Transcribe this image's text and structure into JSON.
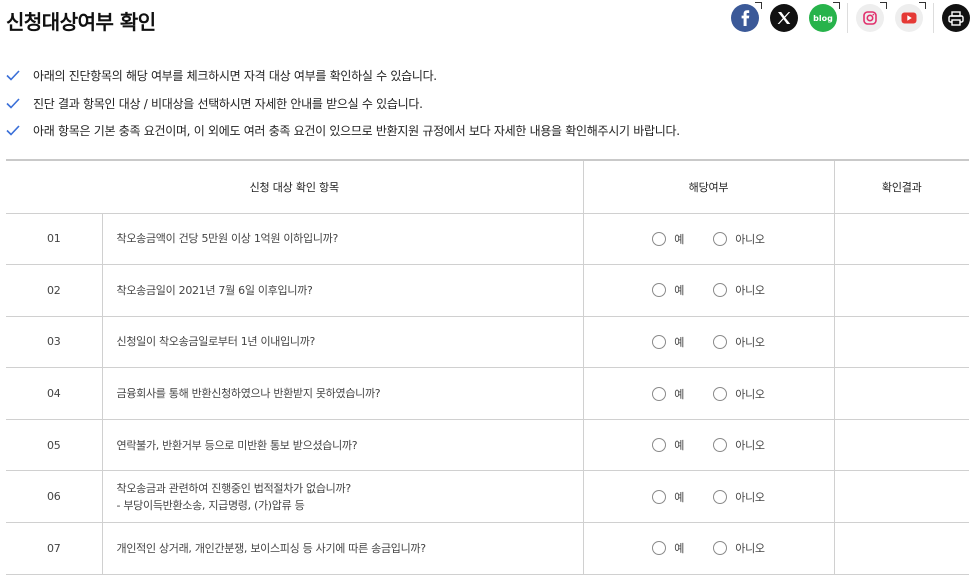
{
  "page": {
    "title": "신청대상여부 확인"
  },
  "share": [
    {
      "name": "facebook-share",
      "icon": "facebook-icon",
      "color": "#3b5998"
    },
    {
      "name": "x-share",
      "icon": "x-icon",
      "color": "#111111"
    },
    {
      "name": "blog-share",
      "icon": "blog-icon",
      "label": "blog",
      "color": "#27b34b"
    },
    {
      "name": "instagram-share",
      "icon": "instagram-icon",
      "color": "#e1306c"
    },
    {
      "name": "youtube-share",
      "icon": "youtube-icon",
      "color": "#e53935"
    },
    {
      "name": "print",
      "icon": "printer-icon",
      "color": "#111111"
    }
  ],
  "notes": [
    "아래의 진단항목의 해당 여부를 체크하시면 자격 대상 여부를 확인하실 수 있습니다.",
    "진단 결과 항목인 대상 / 비대상을 선택하시면 자세한 안내를 받으실 수 있습니다.",
    "아래 항목은 기본 충족 요건이며, 이 외에도 여러 충족 요건이 있으므로 반환지원 규정에서 보다 자세한 내용을 확인해주시기 바랍니다."
  ],
  "table": {
    "headers": {
      "item": "신청 대상 확인 항목",
      "applicable": "해당여부",
      "result": "확인결과"
    },
    "options": {
      "yes": "예",
      "no": "아니오"
    },
    "rows": [
      {
        "num": "01",
        "question": "착오송금액이 건당 5만원 이상 1억원 이하입니까?",
        "sub": ""
      },
      {
        "num": "02",
        "question": "착오송금일이 2021년 7월 6일 이후입니까?",
        "sub": ""
      },
      {
        "num": "03",
        "question": "신청일이 착오송금일로부터 1년 이내입니까?",
        "sub": ""
      },
      {
        "num": "04",
        "question": "금융회사를 통해 반환신청하였으나 반환받지 못하였습니까?",
        "sub": ""
      },
      {
        "num": "05",
        "question": "연락불가, 반환거부 등으로 미반환 통보 받으셨습니까?",
        "sub": ""
      },
      {
        "num": "06",
        "question": "착오송금과 관련하여 진행중인 법적절차가 없습니까?",
        "sub": "- 부당이득반환소송, 지급명령, (가)압류 등"
      },
      {
        "num": "07",
        "question": "개인적인 상거래, 개인간분쟁, 보이스피싱 등 사기에 따른 송금입니까?",
        "sub": ""
      }
    ]
  },
  "colors": {
    "check": "#3a6fd8",
    "border": "#d0d0d0"
  }
}
